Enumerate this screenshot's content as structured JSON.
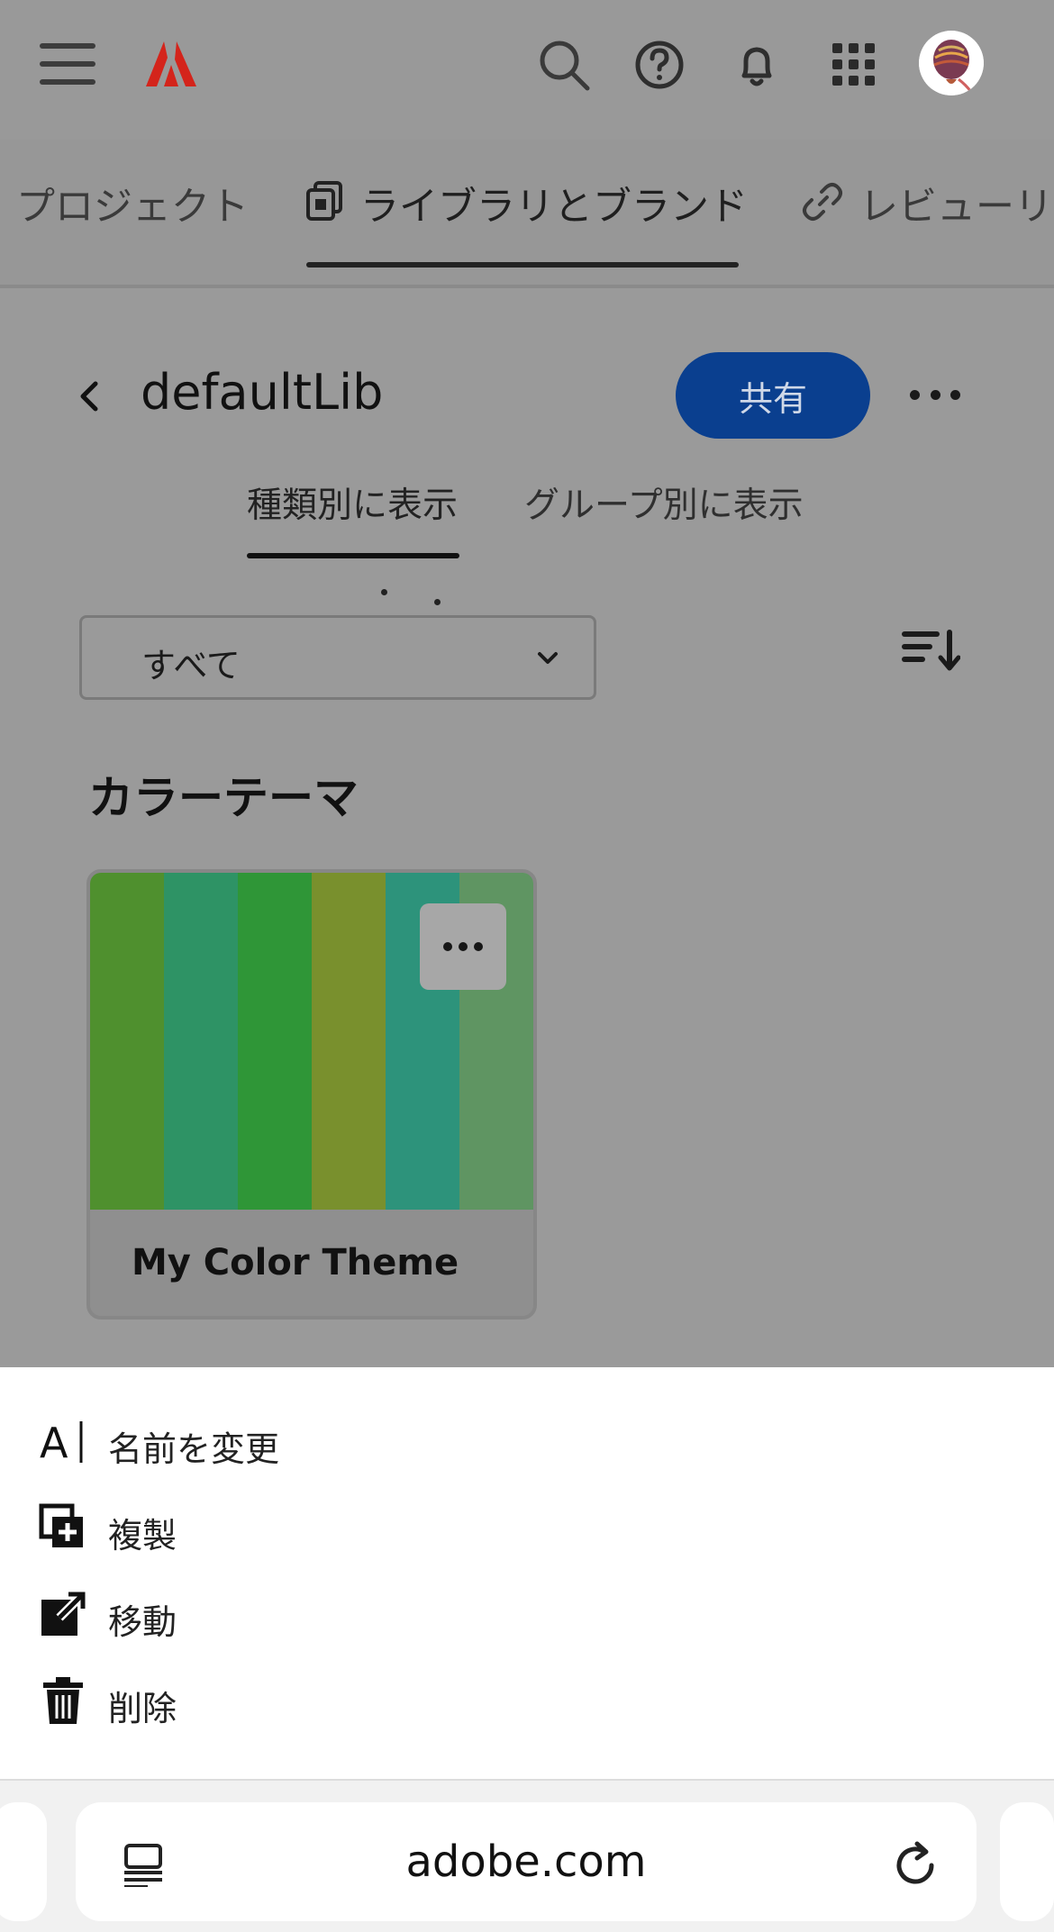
{
  "header": {
    "icons": [
      "menu-icon",
      "adobe-logo",
      "search-icon",
      "help-icon",
      "bell-icon",
      "apps-grid-icon",
      "avatar"
    ]
  },
  "tabs": [
    {
      "label": "プロジェクト"
    },
    {
      "label": "ライブラリとブランド"
    },
    {
      "label": "レビューリン"
    }
  ],
  "library": {
    "title": "defaultLib",
    "share_label": "共有",
    "view_tabs": [
      {
        "label": "種類別に表示"
      },
      {
        "label": "グループ別に表示"
      }
    ],
    "filter_value": "すべて",
    "section_title": "カラーテーマ"
  },
  "theme_card": {
    "label": "My Color Theme",
    "colors": [
      "#4f902e",
      "#2e9365",
      "#2f9637",
      "#79902d",
      "#2d937b",
      "#5f9562"
    ]
  },
  "sheet": {
    "items": [
      {
        "label": "名前を変更",
        "icon": "rename-icon"
      },
      {
        "label": "複製",
        "icon": "duplicate-icon"
      },
      {
        "label": "移動",
        "icon": "move-icon"
      },
      {
        "label": "削除",
        "icon": "trash-icon"
      }
    ]
  },
  "browser": {
    "url": "adobe.com"
  },
  "colors": {
    "accent": "#0a3f8f",
    "overlay": "#9a9a9a",
    "adobe_red": "#e1251b"
  }
}
